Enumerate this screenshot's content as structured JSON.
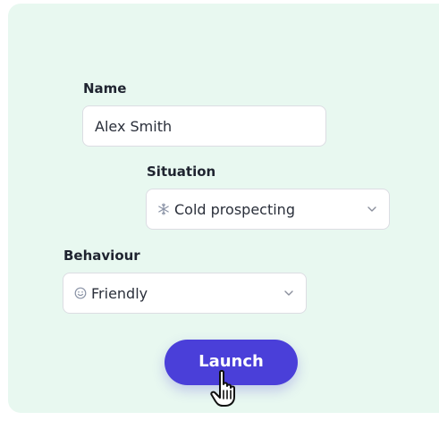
{
  "form": {
    "name_label": "Name",
    "name_value": "Alex Smith",
    "situation_label": "Situation",
    "situation_value": "Cold prospecting",
    "situation_icon": "snowflake-icon",
    "behaviour_label": "Behaviour",
    "behaviour_value": "Friendly",
    "behaviour_icon": "smiley-icon",
    "launch_label": "Launch"
  },
  "colors": {
    "background": "#e8f8f0",
    "accent": "#4a3fd9",
    "field_border": "#dcdde3"
  }
}
